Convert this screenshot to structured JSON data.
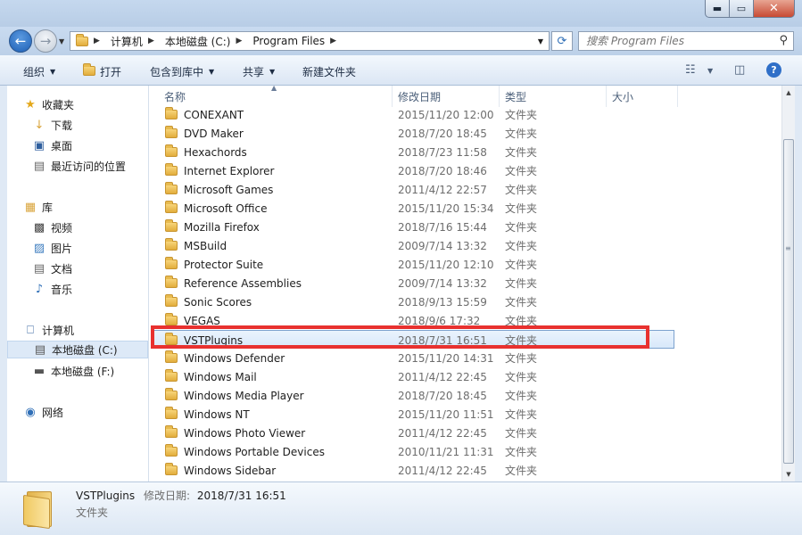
{
  "window": {
    "min_label": "▬",
    "max_label": "▭",
    "close_label": "✕"
  },
  "navbar": {
    "breadcrumb": [
      "计算机",
      "本地磁盘 (C:)",
      "Program Files"
    ],
    "search_placeholder": "搜索 Program Files"
  },
  "toolbar": {
    "organize": "组织",
    "open": "打开",
    "include_library": "包含到库中",
    "share": "共享",
    "new_folder": "新建文件夹"
  },
  "sidebar": {
    "favorites": "收藏夹",
    "downloads": "下载",
    "desktop": "桌面",
    "recent": "最近访问的位置",
    "libraries": "库",
    "videos": "视频",
    "pictures": "图片",
    "documents": "文档",
    "music": "音乐",
    "computer": "计算机",
    "drive_c": "本地磁盘 (C:)",
    "drive_f": "本地磁盘 (F:)",
    "network": "网络"
  },
  "columns": {
    "name": "名称",
    "date": "修改日期",
    "type": "类型",
    "size": "大小"
  },
  "files": [
    {
      "name": "CONEXANT",
      "date": "2015/11/20 12:00",
      "type": "文件夹"
    },
    {
      "name": "DVD Maker",
      "date": "2018/7/20 18:45",
      "type": "文件夹"
    },
    {
      "name": "Hexachords",
      "date": "2018/7/23 11:58",
      "type": "文件夹"
    },
    {
      "name": "Internet Explorer",
      "date": "2018/7/20 18:46",
      "type": "文件夹"
    },
    {
      "name": "Microsoft Games",
      "date": "2011/4/12 22:57",
      "type": "文件夹"
    },
    {
      "name": "Microsoft Office",
      "date": "2015/11/20 15:34",
      "type": "文件夹"
    },
    {
      "name": "Mozilla Firefox",
      "date": "2018/7/16 15:44",
      "type": "文件夹"
    },
    {
      "name": "MSBuild",
      "date": "2009/7/14 13:32",
      "type": "文件夹"
    },
    {
      "name": "Protector Suite",
      "date": "2015/11/20 12:10",
      "type": "文件夹"
    },
    {
      "name": "Reference Assemblies",
      "date": "2009/7/14 13:32",
      "type": "文件夹"
    },
    {
      "name": "Sonic Scores",
      "date": "2018/9/13 15:59",
      "type": "文件夹"
    },
    {
      "name": "VEGAS",
      "date": "2018/9/6 17:32",
      "type": "文件夹"
    },
    {
      "name": "VSTPlugins",
      "date": "2018/7/31 16:51",
      "type": "文件夹"
    },
    {
      "name": "Windows Defender",
      "date": "2015/11/20 14:31",
      "type": "文件夹"
    },
    {
      "name": "Windows Mail",
      "date": "2011/4/12 22:45",
      "type": "文件夹"
    },
    {
      "name": "Windows Media Player",
      "date": "2018/7/20 18:45",
      "type": "文件夹"
    },
    {
      "name": "Windows NT",
      "date": "2015/11/20 11:51",
      "type": "文件夹"
    },
    {
      "name": "Windows Photo Viewer",
      "date": "2011/4/12 22:45",
      "type": "文件夹"
    },
    {
      "name": "Windows Portable Devices",
      "date": "2010/11/21 11:31",
      "type": "文件夹"
    },
    {
      "name": "Windows Sidebar",
      "date": "2011/4/12 22:45",
      "type": "文件夹"
    }
  ],
  "selected_index": 12,
  "details": {
    "name": "VSTPlugins",
    "modified_label": "修改日期:",
    "modified_value": "2018/7/31 16:51",
    "type": "文件夹"
  },
  "colors": {
    "highlight_border": "#e8312f",
    "selection": "#d8e8fa",
    "folder": "#f0c962"
  }
}
